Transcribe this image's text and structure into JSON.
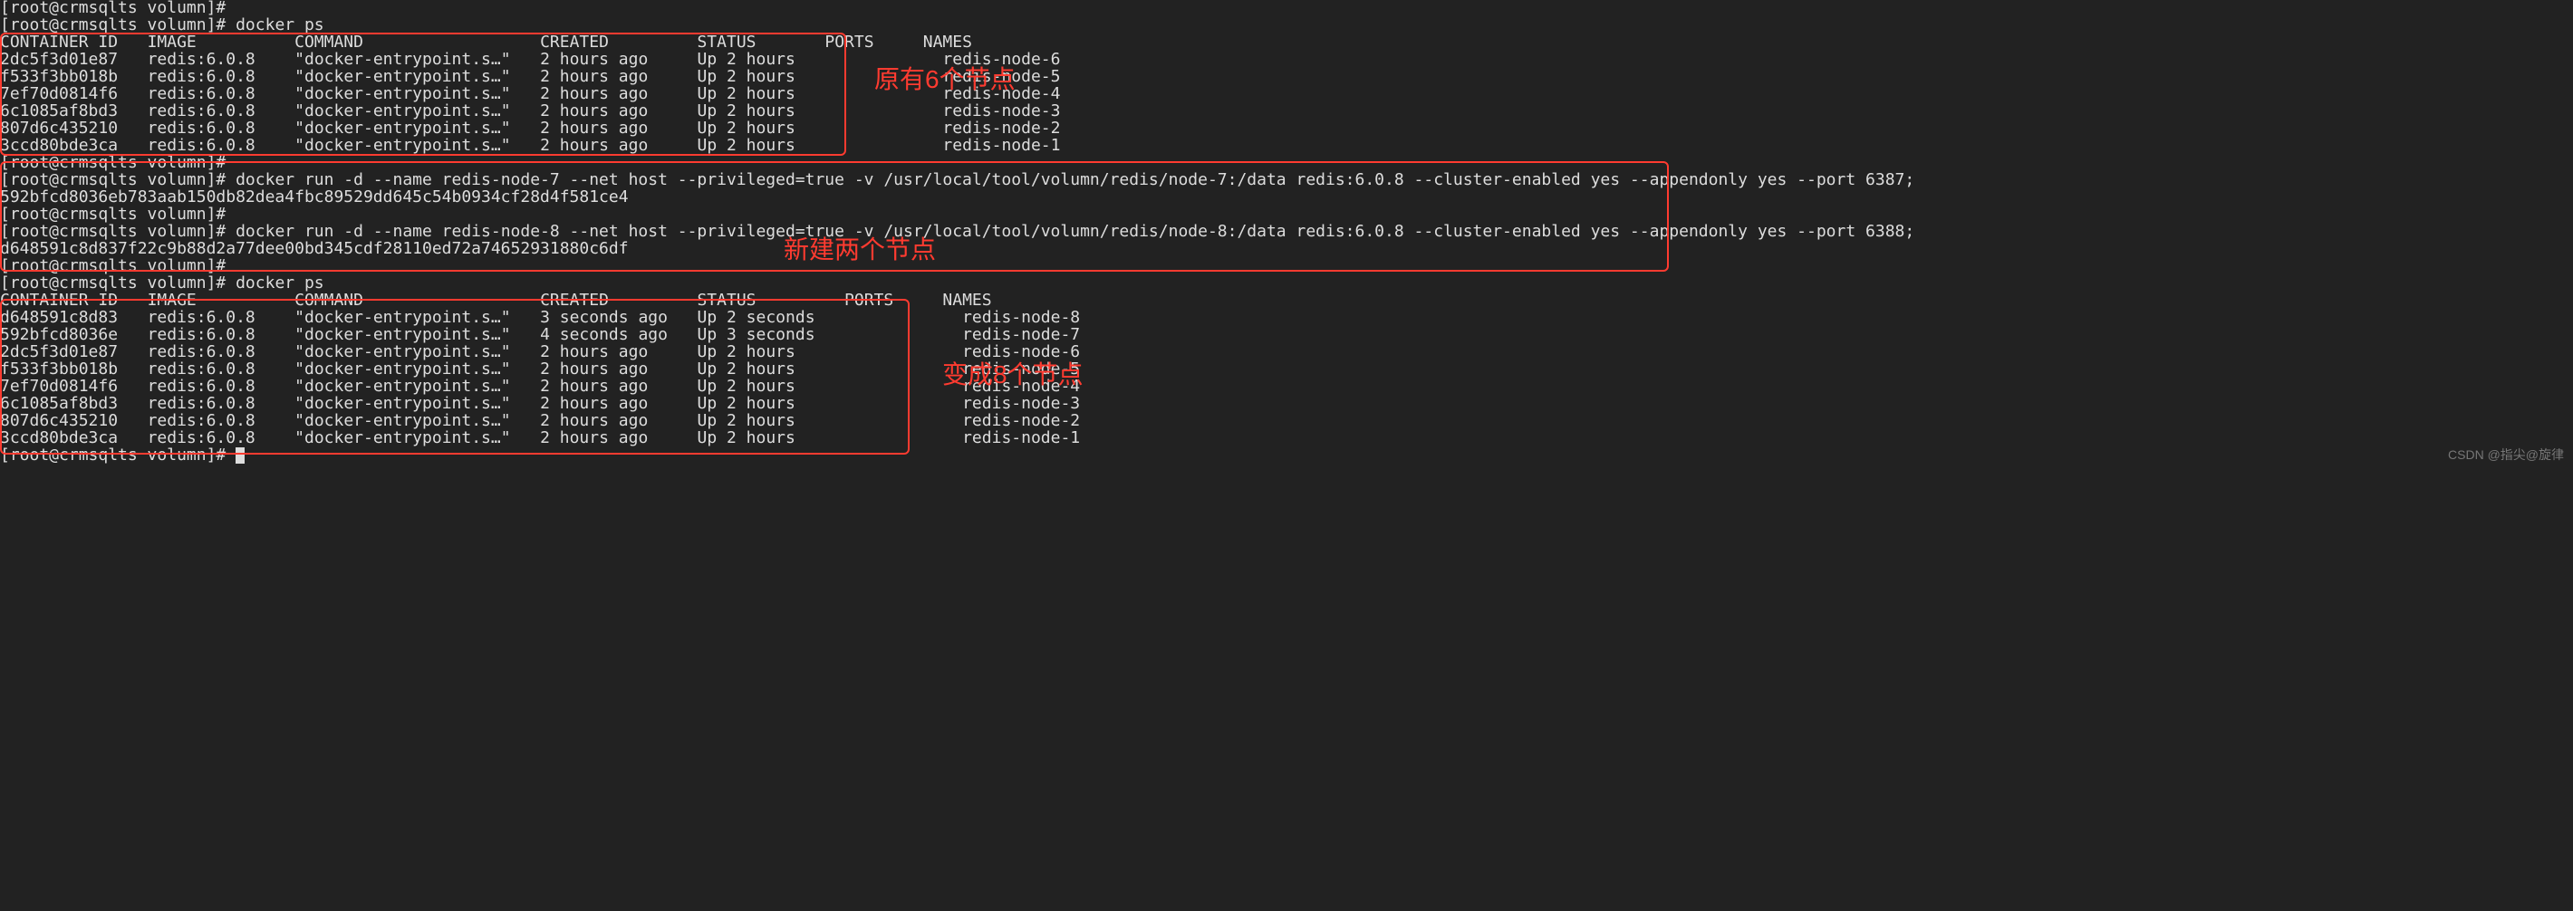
{
  "prompt": {
    "user": "root",
    "host": "crmsqlts",
    "cwd": "volumn",
    "render": "[root@crmsqlts volumn]#"
  },
  "commands": {
    "empty": "",
    "docker_ps": "docker ps",
    "docker_run_7": "docker run -d --name redis-node-7 --net host --privileged=true -v /usr/local/tool/volumn/redis/node-7:/data redis:6.0.8 --cluster-enabled yes --appendonly yes --port 6387;",
    "docker_run_8": "docker run -d --name redis-node-8 --net host --privileged=true -v /usr/local/tool/volumn/redis/node-8:/data redis:6.0.8 --cluster-enabled yes --appendonly yes --port 6388;"
  },
  "hashes": {
    "node7": "592bfcd8036eb783aab150db82dea4fbc89529dd645c54b0934cf28d4f581ce4",
    "node8": "d648591c8d837f22c9b88d2a77dee00bd345cdf28110ed72a74652931880c6df"
  },
  "ps_header": {
    "container_id": "CONTAINER ID",
    "image": "IMAGE",
    "command": "COMMAND",
    "created": "CREATED",
    "status": "STATUS",
    "ports": "PORTS",
    "names": "NAMES"
  },
  "ps1_rows": [
    {
      "id": "2dc5f3d01e87",
      "image": "redis:6.0.8",
      "cmd": "\"docker-entrypoint.s…\"",
      "created": "2 hours ago",
      "status": "Up 2 hours",
      "ports": "",
      "names": "redis-node-6"
    },
    {
      "id": "f533f3bb018b",
      "image": "redis:6.0.8",
      "cmd": "\"docker-entrypoint.s…\"",
      "created": "2 hours ago",
      "status": "Up 2 hours",
      "ports": "",
      "names": "redis-node-5"
    },
    {
      "id": "7ef70d0814f6",
      "image": "redis:6.0.8",
      "cmd": "\"docker-entrypoint.s…\"",
      "created": "2 hours ago",
      "status": "Up 2 hours",
      "ports": "",
      "names": "redis-node-4"
    },
    {
      "id": "6c1085af8bd3",
      "image": "redis:6.0.8",
      "cmd": "\"docker-entrypoint.s…\"",
      "created": "2 hours ago",
      "status": "Up 2 hours",
      "ports": "",
      "names": "redis-node-3"
    },
    {
      "id": "807d6c435210",
      "image": "redis:6.0.8",
      "cmd": "\"docker-entrypoint.s…\"",
      "created": "2 hours ago",
      "status": "Up 2 hours",
      "ports": "",
      "names": "redis-node-2"
    },
    {
      "id": "3ccd80bde3ca",
      "image": "redis:6.0.8",
      "cmd": "\"docker-entrypoint.s…\"",
      "created": "2 hours ago",
      "status": "Up 2 hours",
      "ports": "",
      "names": "redis-node-1"
    }
  ],
  "ps2_rows": [
    {
      "id": "d648591c8d83",
      "image": "redis:6.0.8",
      "cmd": "\"docker-entrypoint.s…\"",
      "created": "3 seconds ago",
      "status": "Up 2 seconds",
      "ports": "",
      "names": "redis-node-8"
    },
    {
      "id": "592bfcd8036e",
      "image": "redis:6.0.8",
      "cmd": "\"docker-entrypoint.s…\"",
      "created": "4 seconds ago",
      "status": "Up 3 seconds",
      "ports": "",
      "names": "redis-node-7"
    },
    {
      "id": "2dc5f3d01e87",
      "image": "redis:6.0.8",
      "cmd": "\"docker-entrypoint.s…\"",
      "created": "2 hours ago",
      "status": "Up 2 hours",
      "ports": "",
      "names": "redis-node-6"
    },
    {
      "id": "f533f3bb018b",
      "image": "redis:6.0.8",
      "cmd": "\"docker-entrypoint.s…\"",
      "created": "2 hours ago",
      "status": "Up 2 hours",
      "ports": "",
      "names": "redis-node-5"
    },
    {
      "id": "7ef70d0814f6",
      "image": "redis:6.0.8",
      "cmd": "\"docker-entrypoint.s…\"",
      "created": "2 hours ago",
      "status": "Up 2 hours",
      "ports": "",
      "names": "redis-node-4"
    },
    {
      "id": "6c1085af8bd3",
      "image": "redis:6.0.8",
      "cmd": "\"docker-entrypoint.s…\"",
      "created": "2 hours ago",
      "status": "Up 2 hours",
      "ports": "",
      "names": "redis-node-3"
    },
    {
      "id": "807d6c435210",
      "image": "redis:6.0.8",
      "cmd": "\"docker-entrypoint.s…\"",
      "created": "2 hours ago",
      "status": "Up 2 hours",
      "ports": "",
      "names": "redis-node-2"
    },
    {
      "id": "3ccd80bde3ca",
      "image": "redis:6.0.8",
      "cmd": "\"docker-entrypoint.s…\"",
      "created": "2 hours ago",
      "status": "Up 2 hours",
      "ports": "",
      "names": "redis-node-1"
    }
  ],
  "annotations": {
    "box1_label": "原有6个节点",
    "box2_label": "新建两个节点",
    "box3_label": "变成8个节点"
  },
  "watermark": "CSDN @指尖@旋律"
}
